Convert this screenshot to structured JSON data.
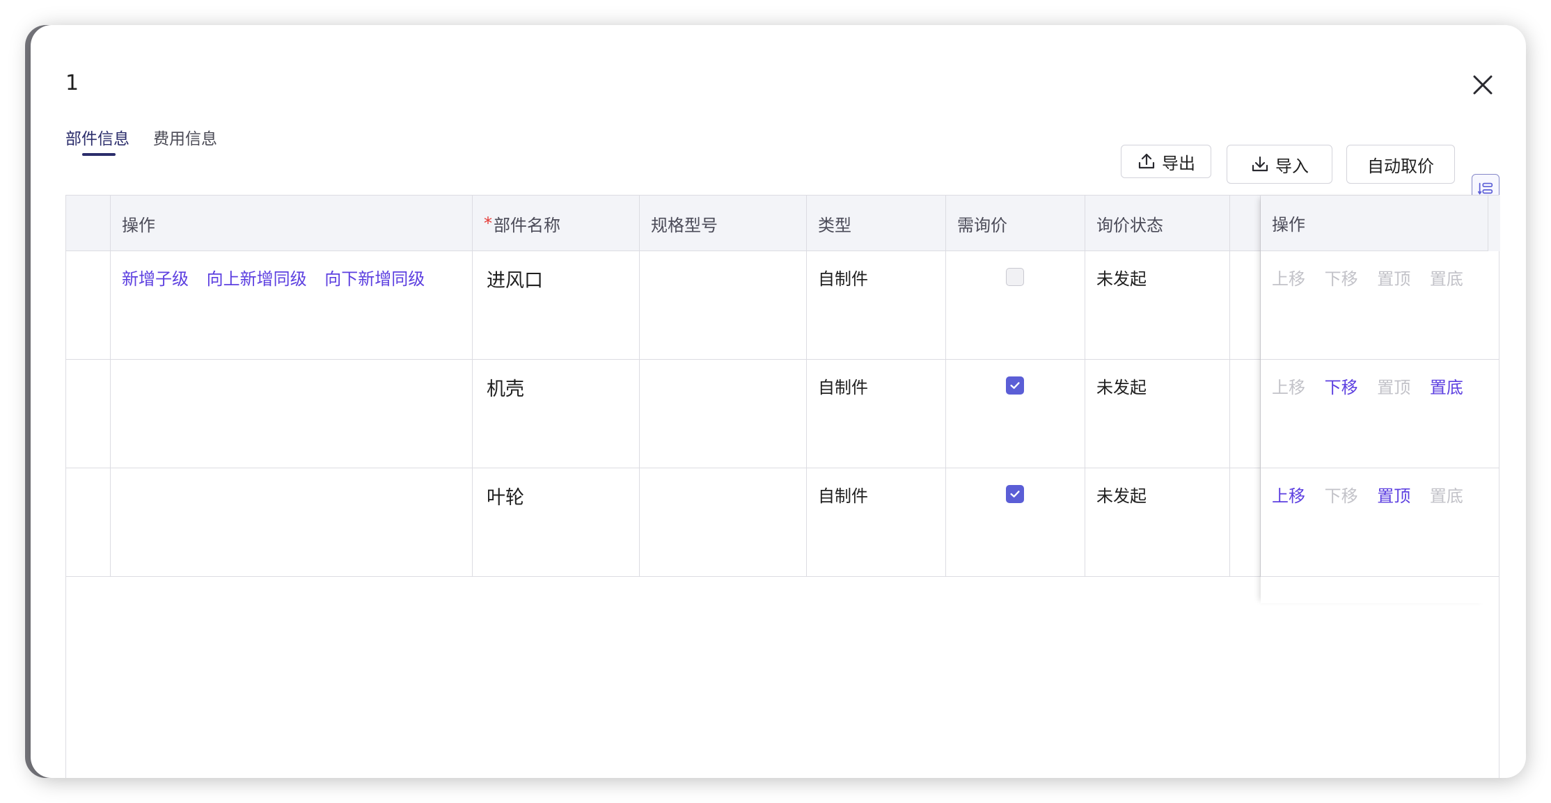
{
  "modal": {
    "title": "1",
    "tabs": [
      {
        "label": "部件信息",
        "active": true
      },
      {
        "label": "费用信息",
        "active": false
      }
    ]
  },
  "toolbar": {
    "export_label": "导出",
    "import_label": "导入",
    "auto_price_label": "自动取价"
  },
  "table": {
    "headers": {
      "actions": "操作",
      "required_mark": "*",
      "part_name": "部件名称",
      "spec": "规格型号",
      "type": "类型",
      "need_inquiry": "需询价",
      "inquiry_status": "询价状态",
      "fixed_actions": "操作"
    },
    "row_actions": {
      "add_child": "新增子级",
      "add_sibling_above": "向上新增同级",
      "add_sibling_below": "向下新增同级"
    },
    "move_actions": {
      "up": "上移",
      "down": "下移",
      "top": "置顶",
      "bottom": "置底"
    },
    "rows": [
      {
        "part_name": "进风口",
        "spec": "",
        "type": "自制件",
        "need_inquiry": false,
        "inquiry_status": "未发起"
      },
      {
        "part_name": "机壳",
        "spec": "",
        "type": "自制件",
        "need_inquiry": true,
        "inquiry_status": "未发起"
      },
      {
        "part_name": "叶轮",
        "spec": "",
        "type": "自制件",
        "need_inquiry": true,
        "inquiry_status": "未发起"
      }
    ]
  },
  "colors": {
    "accent": "#5c3fe0",
    "checkbox": "#5b5ed6",
    "tab_active": "#2b2d6b",
    "disabled": "#c2c2c8"
  }
}
